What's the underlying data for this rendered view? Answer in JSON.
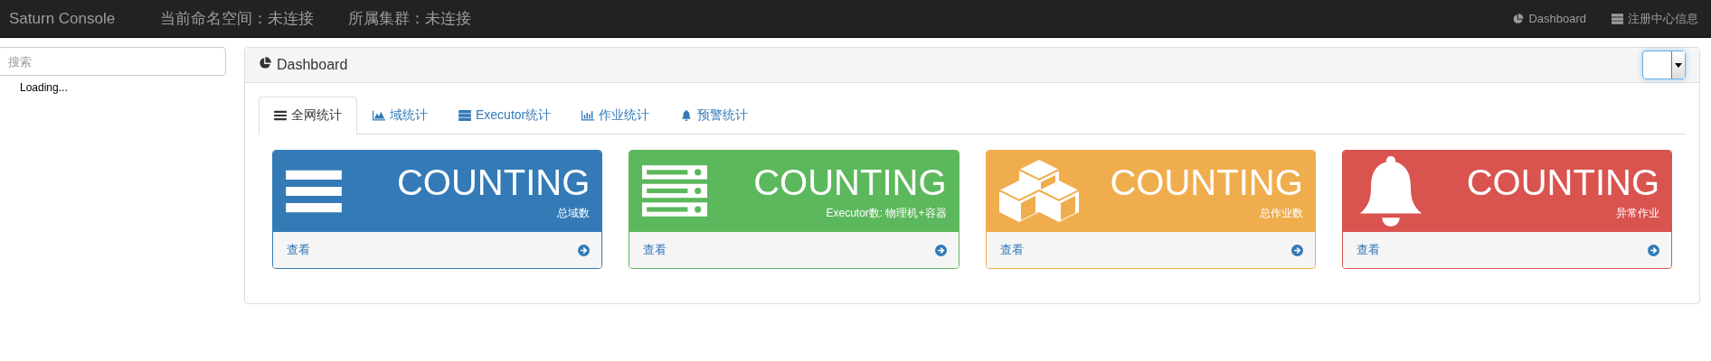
{
  "navbar": {
    "brand": "Saturn Console",
    "status_items": [
      "当前命名空间：未连接",
      "所属集群：未连接"
    ],
    "links": [
      {
        "kind": "pie",
        "label": "Dashboard"
      },
      {
        "kind": "server",
        "label": "注册中心信息"
      }
    ]
  },
  "sidebar": {
    "search": {
      "placeholder": "搜索"
    },
    "loading_text": "Loading..."
  },
  "panel": {
    "title": "Dashboard",
    "tabs": [
      {
        "kind": "list",
        "label": "全网统计",
        "selected": true
      },
      {
        "kind": "area",
        "label": "域统计",
        "selected": false
      },
      {
        "kind": "server",
        "label": "Executor统计",
        "selected": false
      },
      {
        "kind": "bars",
        "label": "作业统计",
        "selected": false
      },
      {
        "kind": "bell",
        "label": "预警统计",
        "selected": false
      }
    ],
    "cards": [
      {
        "kind": "list",
        "color": "#337ab7",
        "count": "COUNTING",
        "label": "总域数",
        "link": "查看"
      },
      {
        "kind": "server",
        "color": "#5cb85c",
        "count": "COUNTING",
        "label": "Executor数: 物理机+容器",
        "link": "查看"
      },
      {
        "kind": "cubes",
        "color": "#f0ad4e",
        "count": "COUNTING",
        "label": "总作业数",
        "link": "查看"
      },
      {
        "kind": "bell",
        "color": "#d9534f",
        "count": "COUNTING",
        "label": "异常作业",
        "link": "查看"
      }
    ]
  }
}
